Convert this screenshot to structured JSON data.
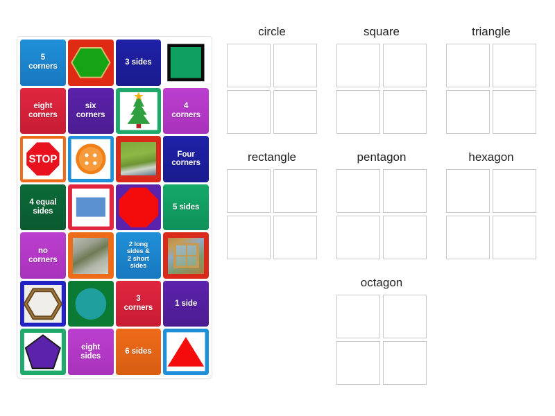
{
  "app": {
    "background_color": "#ffffff",
    "panel_border_color": "#e3e3e3",
    "slot_border_color": "#c8c8c8",
    "title_color": "#232323"
  },
  "tile_panel": {
    "name": "draggable-tiles",
    "columns": 4,
    "rows": 7,
    "tiles": [
      {
        "id": "t1",
        "label": "5\ncorners",
        "kind": "text",
        "bg": "#1f90d8",
        "bg2": "#1878c0"
      },
      {
        "id": "t2",
        "label": "",
        "kind": "hexagon",
        "bg": "#e02b14",
        "shape_fill": "#16a314",
        "shape_stroke": "#d9b96a"
      },
      {
        "id": "t3",
        "label": "3 sides",
        "kind": "text",
        "bg": "#1f21a8",
        "bg2": "#191b8e"
      },
      {
        "id": "t4",
        "label": "",
        "kind": "square-outline",
        "bg": "#ffffff",
        "shape_fill": "#0f9f5e",
        "shape_stroke": "#0a0a0a"
      },
      {
        "id": "t5",
        "label": "eight\ncorners",
        "kind": "text",
        "bg": "#e0263f",
        "bg2": "#c71d34"
      },
      {
        "id": "t6",
        "label": "six\ncorners",
        "kind": "text",
        "bg": "#5b22ab",
        "bg2": "#4c1c91"
      },
      {
        "id": "t7",
        "label": "",
        "kind": "christmas-tree",
        "bg": "#1fa96a",
        "photo": "christmas-tree-photo"
      },
      {
        "id": "t8",
        "label": "4\ncorners",
        "kind": "text",
        "bg": "#bc3fcf",
        "bg2": "#a832bb"
      },
      {
        "id": "t9",
        "label": "STOP",
        "kind": "stop-sign",
        "bg": "#ee6b19",
        "photo": "stop-sign-photo"
      },
      {
        "id": "t10",
        "label": "",
        "kind": "button",
        "bg": "#1f90d8",
        "photo": "orange-button-photo"
      },
      {
        "id": "t11",
        "label": "",
        "kind": "photo",
        "bg": "#d8291a",
        "photo": "grass-field-photo"
      },
      {
        "id": "t12",
        "label": "Four\ncorners",
        "kind": "text",
        "bg": "#1f21a8",
        "bg2": "#191b8e"
      },
      {
        "id": "t13",
        "label": "4 equal\nsides",
        "kind": "text",
        "bg": "#0b6b38",
        "bg2": "#095a2f"
      },
      {
        "id": "t14",
        "label": "",
        "kind": "rectangle",
        "bg": "#e0263f",
        "shape_fill": "#5a8fd0"
      },
      {
        "id": "t15",
        "label": "",
        "kind": "octagon",
        "bg": "#5b22ab",
        "shape_fill": "#f40b0b"
      },
      {
        "id": "t16",
        "label": "5 sides",
        "kind": "text",
        "bg": "#14a96a",
        "bg2": "#0f9159"
      },
      {
        "id": "t17",
        "label": "no\ncorners",
        "kind": "text",
        "bg": "#bc3fcf",
        "bg2": "#a832bb"
      },
      {
        "id": "t18",
        "label": "",
        "kind": "photo",
        "bg": "#ee6b19",
        "photo": "aerial-building-photo"
      },
      {
        "id": "t19",
        "label": "2 long\nsides &\n2 short\nsides",
        "kind": "text-small",
        "bg": "#1f90d8",
        "bg2": "#1878c0"
      },
      {
        "id": "t20",
        "label": "",
        "kind": "photo",
        "bg": "#d8291a",
        "photo": "window-photo"
      },
      {
        "id": "t21",
        "label": "",
        "kind": "wood-hexagon",
        "bg": "#2222c4",
        "photo": "wooden-hexagon-photo"
      },
      {
        "id": "t22",
        "label": "",
        "kind": "circle",
        "bg": "#0b7a33",
        "shape_fill": "#1f9e9e"
      },
      {
        "id": "t23",
        "label": "3\ncorners",
        "kind": "text",
        "bg": "#e0263f",
        "bg2": "#c71d34"
      },
      {
        "id": "t24",
        "label": "1 side",
        "kind": "text",
        "bg": "#5b22ab",
        "bg2": "#4c1c91"
      },
      {
        "id": "t25",
        "label": "",
        "kind": "pentagon",
        "bg": "#1fa96a",
        "shape_fill": "#5b22ab",
        "shape_stroke": "#1a1a1a"
      },
      {
        "id": "t26",
        "label": "eight\nsides",
        "kind": "text",
        "bg": "#bc3fcf",
        "bg2": "#a832bb"
      },
      {
        "id": "t27",
        "label": "6 sides",
        "kind": "text",
        "bg": "#ee6b19",
        "bg2": "#d85e12"
      },
      {
        "id": "t28",
        "label": "",
        "kind": "triangle",
        "bg": "#1f90d8",
        "shape_fill": "#f40b0b"
      }
    ]
  },
  "drop_groups": [
    {
      "id": "g1",
      "title": "circle",
      "slot_count": 4
    },
    {
      "id": "g2",
      "title": "square",
      "slot_count": 4
    },
    {
      "id": "g3",
      "title": "triangle",
      "slot_count": 4
    },
    {
      "id": "g4",
      "title": "rectangle",
      "slot_count": 4
    },
    {
      "id": "g5",
      "title": "pentagon",
      "slot_count": 4
    },
    {
      "id": "g6",
      "title": "hexagon",
      "slot_count": 4
    },
    {
      "id": "g7",
      "title": "octagon",
      "slot_count": 4
    }
  ]
}
